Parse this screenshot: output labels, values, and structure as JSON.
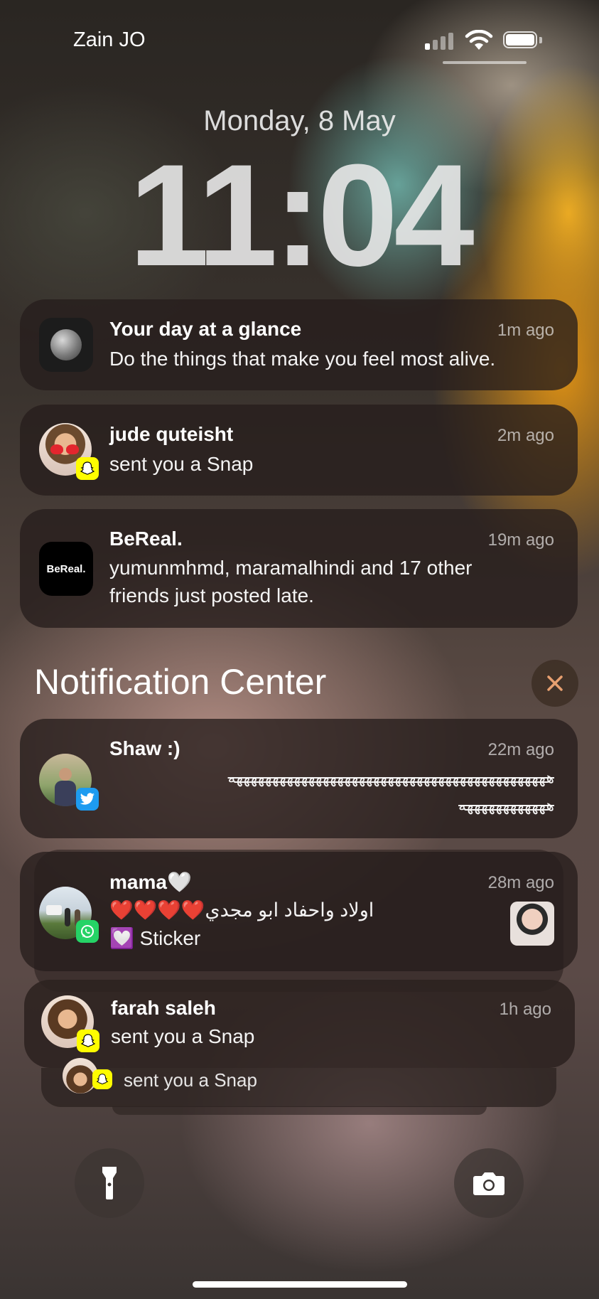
{
  "status_bar": {
    "carrier": "Zain JO",
    "signal_bars_active": 1,
    "signal_bars_total": 4,
    "battery_level": 0.9
  },
  "lock_screen": {
    "date": "Monday, 8 May",
    "time": "11:04"
  },
  "notifications": [
    {
      "app": "moon-app",
      "title": "Your day at a glance",
      "time": "1m ago",
      "body": "Do the things that make you feel most alive."
    },
    {
      "app": "snapchat",
      "title": "jude quteisht",
      "time": "2m ago",
      "body": "sent you a Snap"
    },
    {
      "app": "bereal",
      "icon_text": "BeReal.",
      "title": "BeReal.",
      "time": "19m ago",
      "body_line1": "yumunmhmd, maramalhindi and 17 other",
      "body_line2": "friends just posted late."
    }
  ],
  "notification_center": {
    "title": "Notification Center",
    "items": [
      {
        "app": "twitter",
        "title": "Shaw :)",
        "time": "22m ago",
        "body_line1": "ههههههههههههههههههههههههههههههههههههههههههههه",
        "body_line2": "ههههههههههههه"
      },
      {
        "app": "whatsapp",
        "title": "mama🤍",
        "time": "28m ago",
        "body_line1": "❤️❤️❤️❤️اولاد واحفاد ابو مجدي",
        "body_line2": "💟 Sticker"
      },
      {
        "app": "snapchat",
        "title": "farah saleh",
        "time": "1h ago",
        "body": "sent you a Snap"
      },
      {
        "app": "snapchat",
        "body": "sent you a Snap"
      }
    ]
  },
  "accent_colors": {
    "snapchat": "#FFFC00",
    "twitter": "#1D9BF0",
    "whatsapp": "#25D366",
    "card_bg": "#261E1C"
  },
  "icons": [
    "flashlight-icon",
    "camera-icon",
    "close-icon"
  ]
}
